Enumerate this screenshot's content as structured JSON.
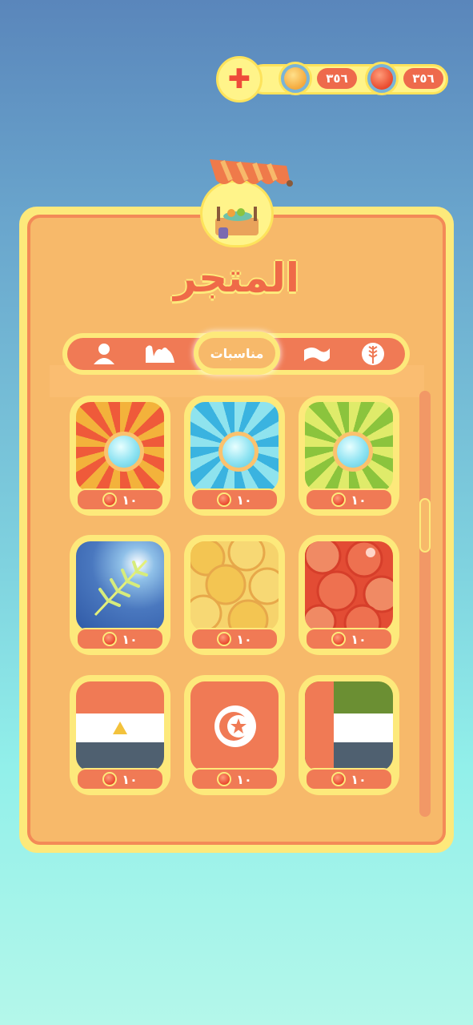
{
  "header": {
    "plus_icon": "plus-icon",
    "wheat_currency": {
      "icon": "wheat-coin-icon",
      "amount": "٣٥٦"
    },
    "red_currency": {
      "icon": "red-gem-icon",
      "amount": "٣٥٦"
    }
  },
  "shop": {
    "title": "المتجر",
    "stall_icon": "market-stall-icon"
  },
  "tabs": [
    {
      "name": "tab-profile",
      "icon": "person-icon"
    },
    {
      "name": "tab-camel",
      "icon": "camel-icon"
    },
    {
      "name": "tab-occasions",
      "label": "مناسبات",
      "active": true
    },
    {
      "name": "tab-flag",
      "icon": "flag-icon"
    },
    {
      "name": "tab-wheat",
      "icon": "wheat-icon"
    }
  ],
  "items": [
    {
      "name": "item-orange-sunburst",
      "price": "١٠",
      "colors": [
        "#f3b23b",
        "#ef5a3a"
      ]
    },
    {
      "name": "item-blue-sunburst",
      "price": "١٠",
      "colors": [
        "#8fe3ee",
        "#3ab3e0"
      ]
    },
    {
      "name": "item-green-sunburst",
      "price": "١٠",
      "colors": [
        "#dfeb6a",
        "#8bc43d"
      ]
    },
    {
      "name": "item-blue-wheat",
      "price": "١٠",
      "colors": [
        "#2f59a6",
        "#8fc0e8"
      ]
    },
    {
      "name": "item-gold-coins",
      "price": "١٠",
      "colors": [
        "#f6d36c",
        "#e7a84a"
      ]
    },
    {
      "name": "item-red-coins",
      "price": "١٠",
      "colors": [
        "#f08a64",
        "#e34c34"
      ]
    },
    {
      "name": "item-flag-egypt",
      "price": "١٠"
    },
    {
      "name": "item-flag-tunisia",
      "price": "١٠"
    },
    {
      "name": "item-flag-uae",
      "price": "١٠"
    }
  ]
}
